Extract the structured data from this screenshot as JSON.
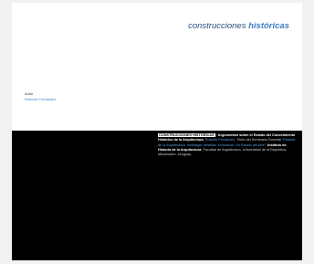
{
  "cover": {
    "brand_prefix": "construcciones ",
    "brand_emphasis": "históricas"
  },
  "author": {
    "label": "Autor",
    "name": "Roberto Fernández"
  },
  "credit": {
    "series_title": "CONSTRUCCIONES HISTÓRICAS",
    "separator": " / ",
    "heading": "Argumentos sobre el Estado del Conocimiento Histórico de la Arquitectura.",
    "author": "Roberto Fernández.",
    "intro": " Texto del Seminario Docente ",
    "seminar": "“Historia de la Arquitectura. Investigar, enseñar, comunicar. Un Estado del Arte”",
    "sep2": ", ",
    "institute": "Instituto de Historia de la Arquitectura",
    "rest": ", Facultad de Arquitectura, Universidad de la República, Montevideo, Uruguay."
  }
}
